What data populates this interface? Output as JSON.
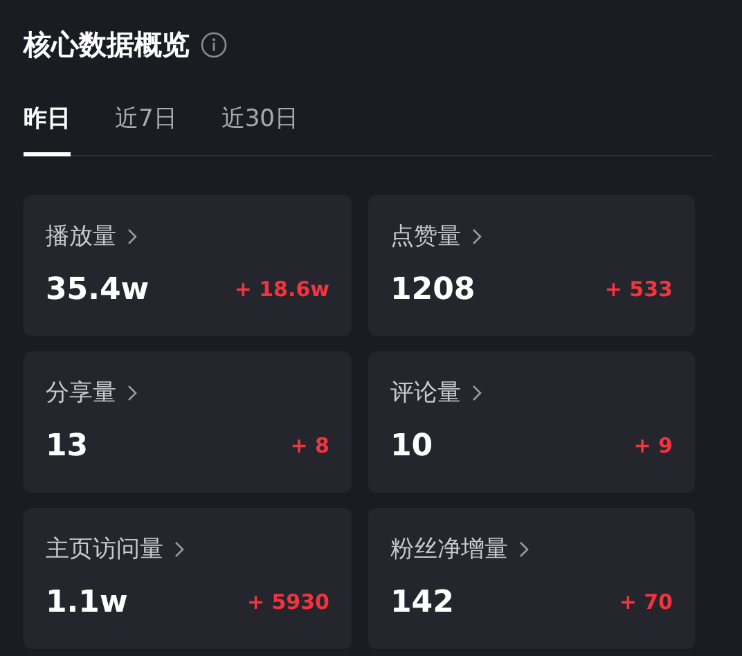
{
  "title": "核心数据概览",
  "tabs": [
    {
      "label": "昨日",
      "selected": true
    },
    {
      "label": "近7日",
      "selected": false
    },
    {
      "label": "近30日",
      "selected": false
    }
  ],
  "metrics": [
    {
      "label": "播放量",
      "value": "35.4w",
      "delta": "+ 18.6w"
    },
    {
      "label": "点赞量",
      "value": "1208",
      "delta": "+ 533"
    },
    {
      "label": "分享量",
      "value": "13",
      "delta": "+ 8"
    },
    {
      "label": "评论量",
      "value": "10",
      "delta": "+ 9"
    },
    {
      "label": "主页访问量",
      "value": "1.1w",
      "delta": "+ 5930"
    },
    {
      "label": "粉丝净增量",
      "value": "142",
      "delta": "+ 70"
    }
  ]
}
